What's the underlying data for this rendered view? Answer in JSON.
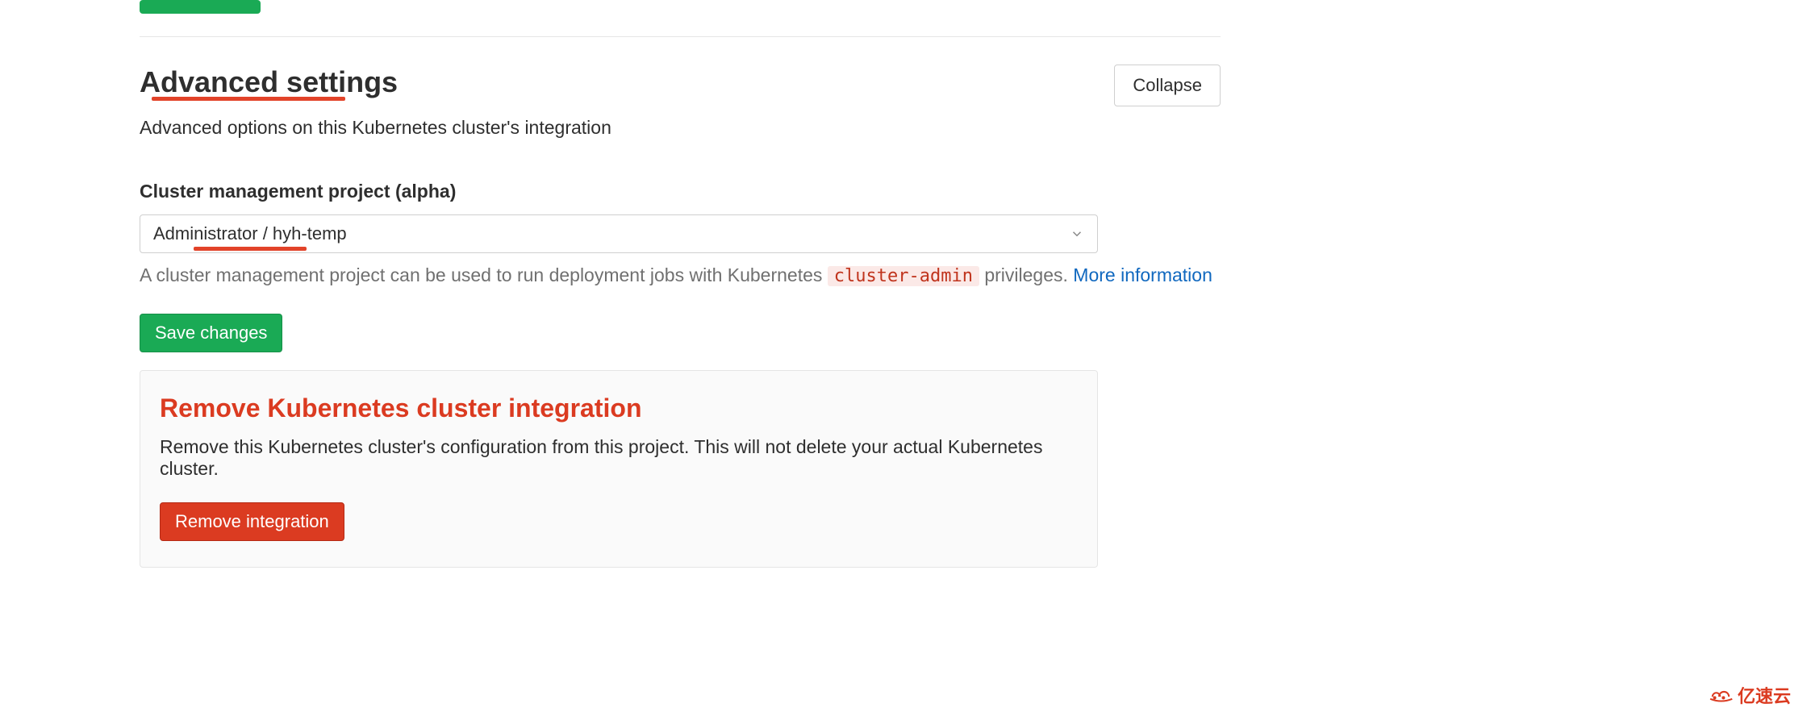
{
  "section": {
    "title": "Advanced settings",
    "subtitle": "Advanced options on this Kubernetes cluster's integration",
    "collapse_label": "Collapse"
  },
  "field": {
    "label": "Cluster management project (alpha)",
    "selected": "Administrator / hyh-temp"
  },
  "help": {
    "pre": "A cluster management project can be used to run deployment jobs with Kubernetes ",
    "code": "cluster-admin",
    "post": " privileges. ",
    "link": "More information"
  },
  "save": {
    "label": "Save changes"
  },
  "remove": {
    "title": "Remove Kubernetes cluster integration",
    "desc": "Remove this Kubernetes cluster's configuration from this project. This will not delete your actual Kubernetes cluster.",
    "button": "Remove integration"
  },
  "watermark": {
    "text": "亿速云"
  }
}
